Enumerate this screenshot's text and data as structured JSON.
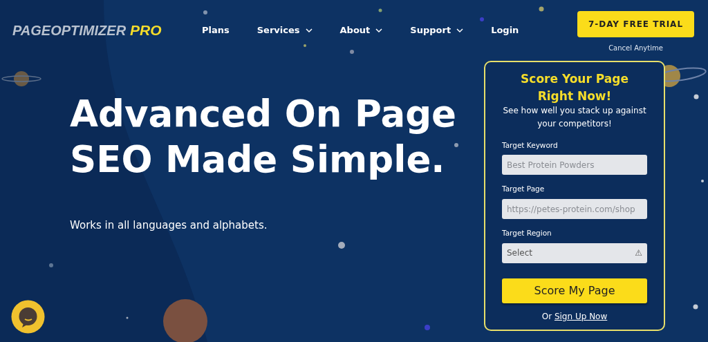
{
  "logo": {
    "main": "PAGEOPTIMIZER",
    "accent": "PRO"
  },
  "nav": [
    {
      "label": "Plans",
      "has_menu": false
    },
    {
      "label": "Services",
      "has_menu": true
    },
    {
      "label": "About",
      "has_menu": true
    },
    {
      "label": "Support",
      "has_menu": true
    },
    {
      "label": "Login",
      "has_menu": false
    }
  ],
  "trial": {
    "button": "7-DAY FREE TRIAL",
    "note": "Cancel Anytime"
  },
  "hero": {
    "heading": "Advanced On Page SEO Made Simple.",
    "subtitle": "Works in all languages and alphabets."
  },
  "form": {
    "title": "Score Your Page Right Now!",
    "subtitle": "See how well you stack up against your competitors!",
    "fields": [
      {
        "kind": "text",
        "label": "Target Keyword",
        "placeholder": "Best Protein Powders"
      },
      {
        "kind": "text",
        "label": "Target Page",
        "placeholder": "https://petes-protein.com/shop"
      },
      {
        "kind": "select",
        "label": "Target Region",
        "value": "Select",
        "icon": "⚠"
      }
    ],
    "submit": "Score My Page",
    "alt_prefix": "Or",
    "alt_link": "Sign Up Now"
  }
}
